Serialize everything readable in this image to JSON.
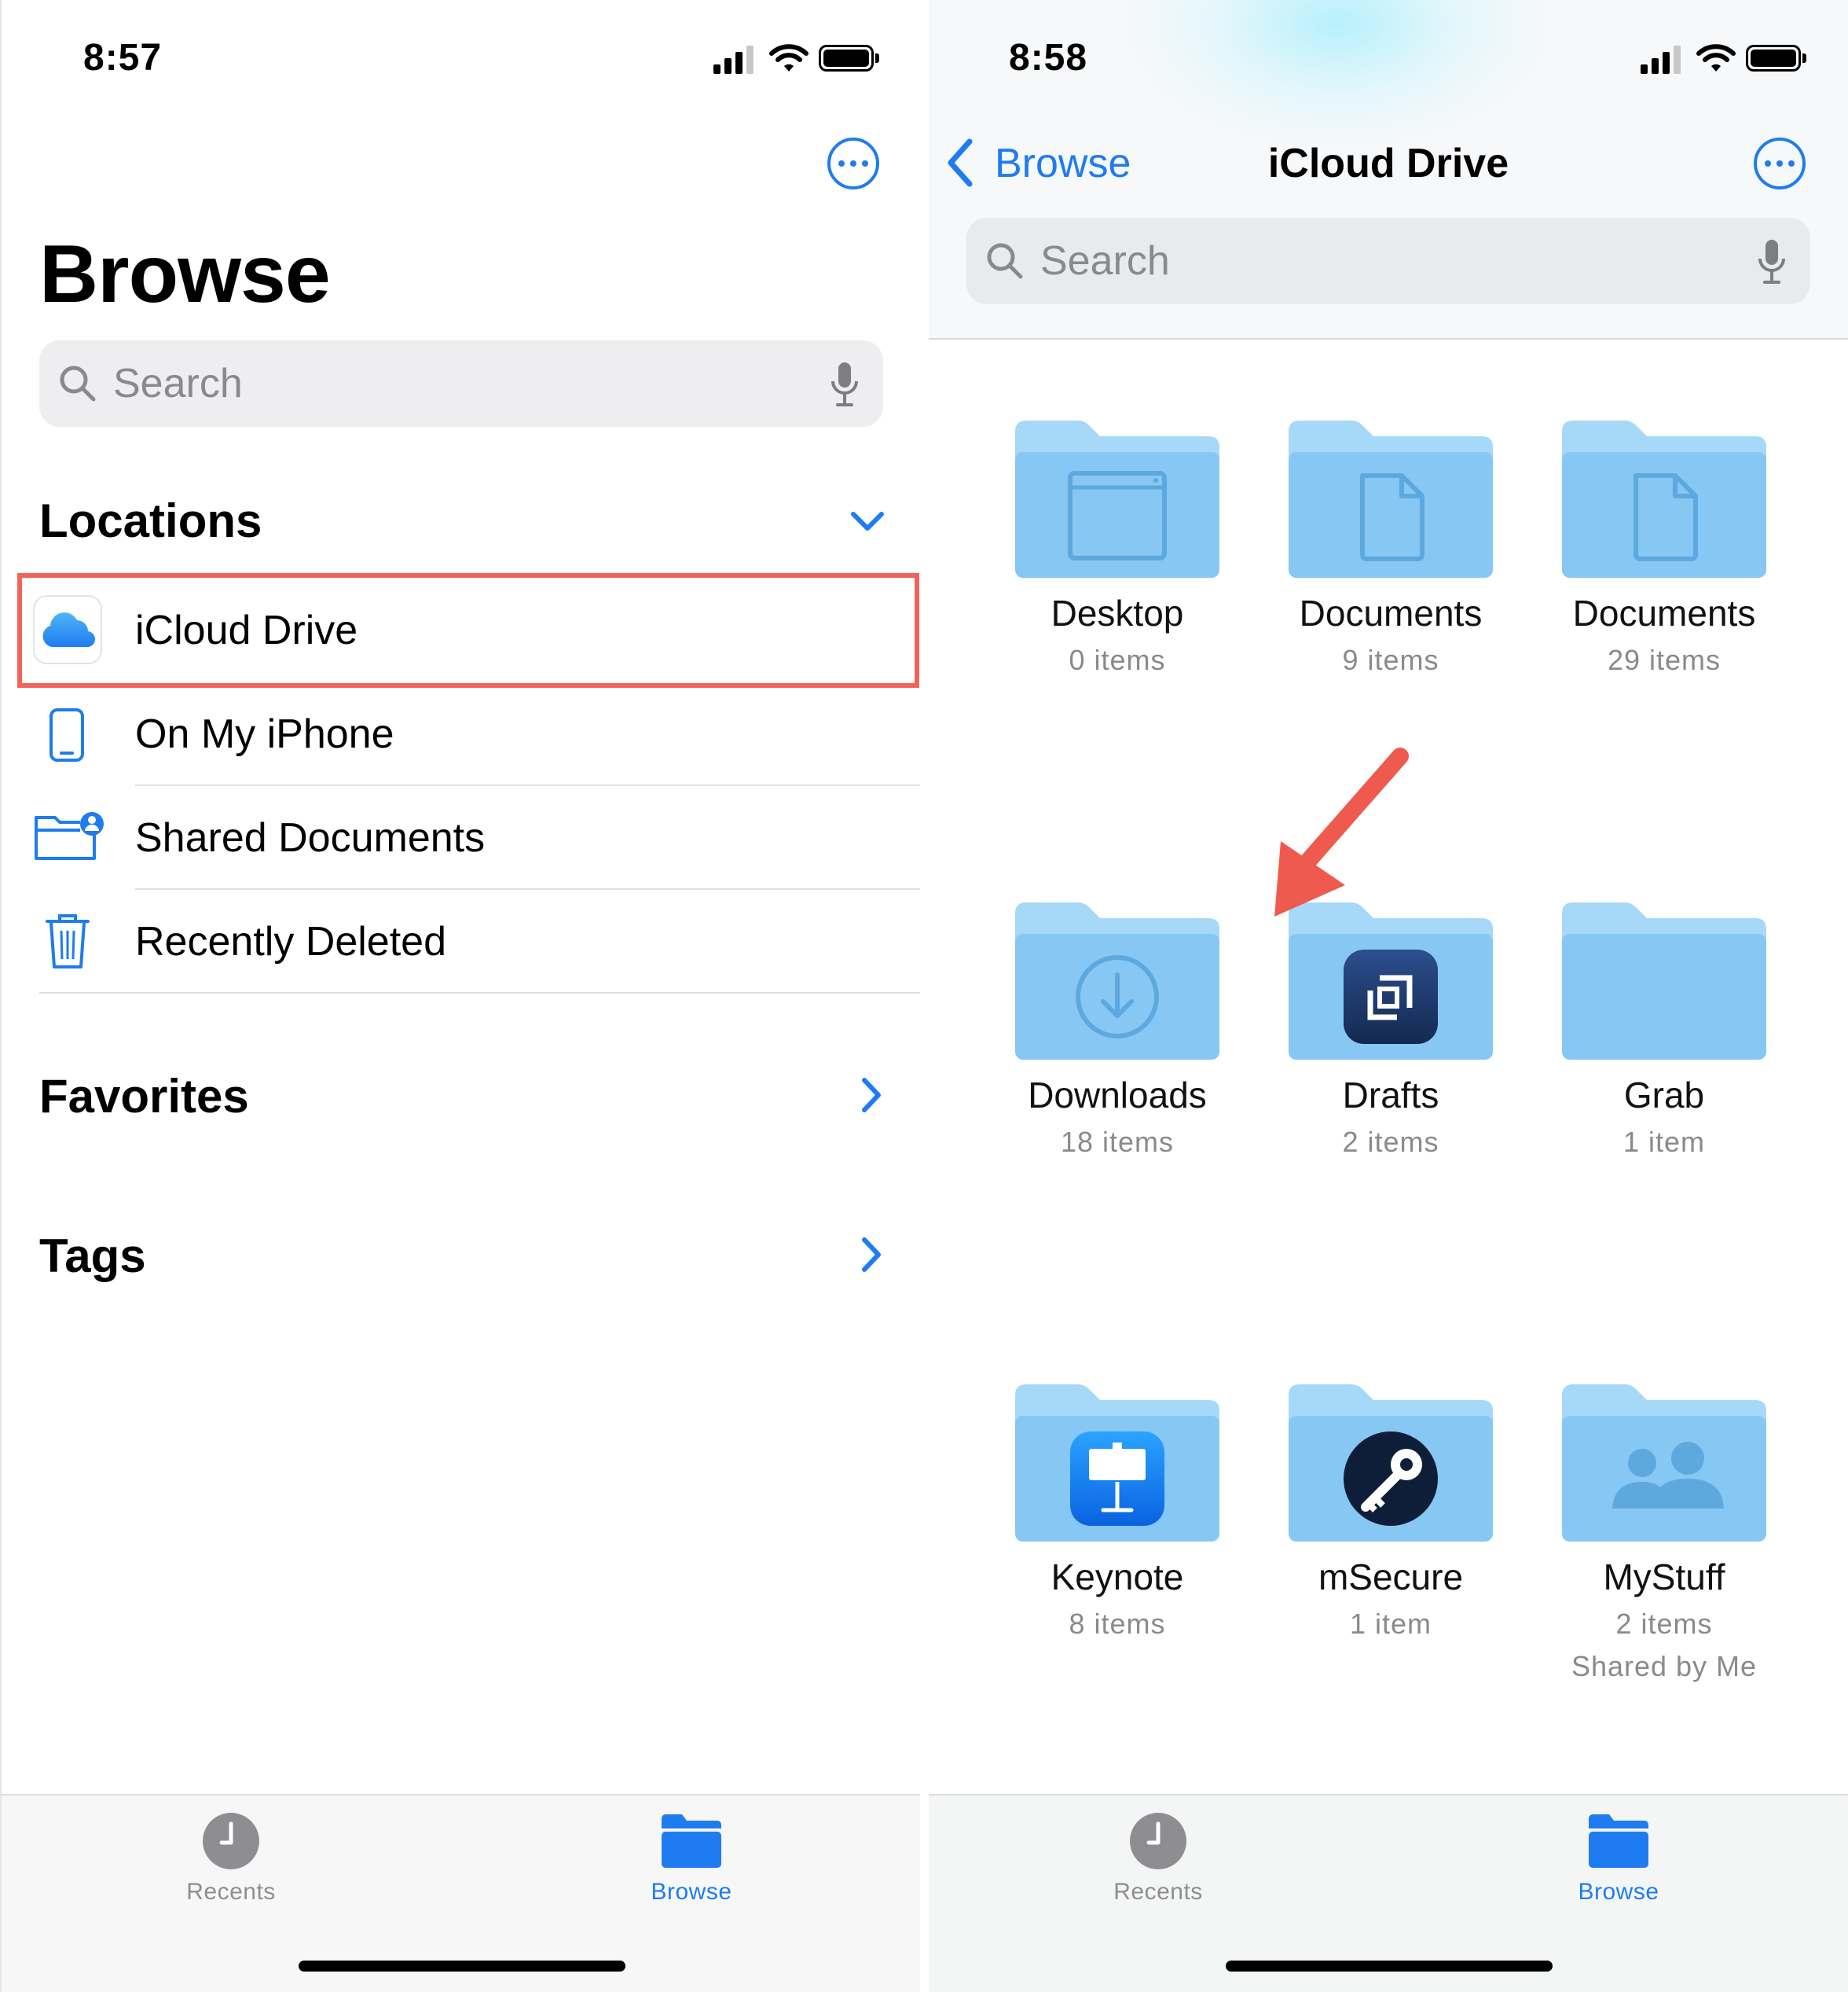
{
  "left": {
    "status": {
      "time": "8:57"
    },
    "title": "Browse",
    "search": {
      "placeholder": "Search"
    },
    "locations": {
      "header": "Locations",
      "items": [
        {
          "label": "iCloud Drive",
          "icon": "icloud-icon",
          "highlighted": true
        },
        {
          "label": "On My iPhone",
          "icon": "iphone-icon"
        },
        {
          "label": "Shared Documents",
          "icon": "shared-folder-icon"
        },
        {
          "label": "Recently Deleted",
          "icon": "trash-icon"
        }
      ]
    },
    "favorites": {
      "header": "Favorites"
    },
    "tags": {
      "header": "Tags"
    },
    "tabbar": {
      "recents": "Recents",
      "browse": "Browse"
    }
  },
  "right": {
    "status": {
      "time": "8:58"
    },
    "nav": {
      "back_label": "Browse",
      "title": "iCloud Drive"
    },
    "search": {
      "placeholder": "Search"
    },
    "folders": [
      {
        "name": "Desktop",
        "count": "0 items",
        "icon": "window-icon"
      },
      {
        "name": "Documents",
        "count": "9 items",
        "icon": "document-icon"
      },
      {
        "name": "Documents",
        "count": "29 items",
        "icon": "document-icon"
      },
      {
        "name": "Downloads",
        "count": "18 items",
        "icon": "download-icon"
      },
      {
        "name": "Drafts",
        "count": "2 items",
        "icon": "drafts-app-icon"
      },
      {
        "name": "Grab",
        "count": "1 item",
        "icon": "none"
      },
      {
        "name": "Keynote",
        "count": "8 items",
        "icon": "keynote-app-icon"
      },
      {
        "name": "mSecure",
        "count": "1 item",
        "icon": "msecure-app-icon"
      },
      {
        "name": "MyStuff",
        "count": "2 items",
        "extra": "Shared by Me",
        "icon": "people-icon"
      }
    ],
    "tabbar": {
      "recents": "Recents",
      "browse": "Browse"
    }
  },
  "colors": {
    "accent": "#1f7cf0",
    "folder_light": "#9fd3f7",
    "folder_body": "#87c8f3",
    "highlight": "#f2635a",
    "annotation_arrow": "#ef5a4f"
  }
}
